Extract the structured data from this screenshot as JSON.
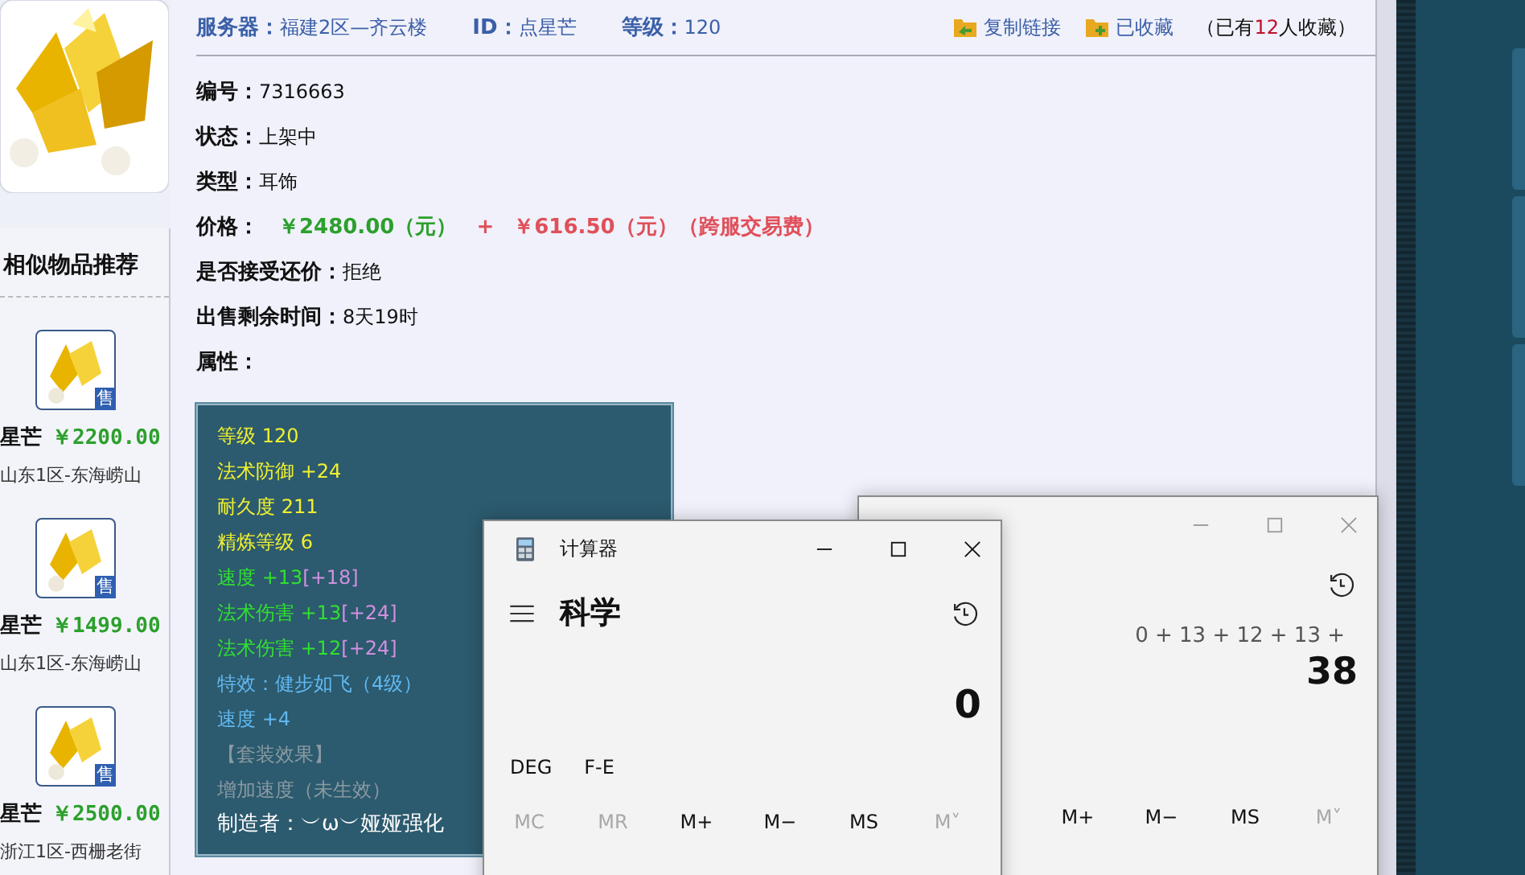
{
  "similar": {
    "title": "相似物品推荐",
    "items": [
      {
        "name": "星芒",
        "price": "￥2200.00",
        "server": "山东1区-东海崂山",
        "badge": "售"
      },
      {
        "name": "星芒",
        "price": "￥1499.00",
        "server": "山东1区-东海崂山",
        "badge": "售"
      },
      {
        "name": "星芒",
        "price": "￥2500.00",
        "server": "浙江1区-西栅老街",
        "badge": "售"
      }
    ]
  },
  "header": {
    "server_label": "服务器：",
    "server": "福建2区—齐云楼",
    "id_label": "ID：",
    "id": "点星芒",
    "level_label": "等级：",
    "level": "120",
    "copy_link": "复制链接",
    "favorite": "已收藏",
    "fav_prefix": "（已有",
    "fav_count": "12",
    "fav_suffix": "人收藏）"
  },
  "fields": [
    {
      "kind": "text",
      "label": "编号：",
      "value": "7316663"
    },
    {
      "kind": "text",
      "label": "状态：",
      "value": " 上架中"
    },
    {
      "kind": "text",
      "label": "类型：",
      "value": "耳饰"
    },
    {
      "kind": "price",
      "label": "价格：",
      "value": "￥2480.00（元）",
      "plus": "+",
      "fee": "￥616.50（元）（跨服交易费）"
    },
    {
      "kind": "text",
      "label": "是否接受还价：",
      "value": "拒绝"
    },
    {
      "kind": "text",
      "label": "出售剩余时间：",
      "value": "8天19时"
    },
    {
      "kind": "heading",
      "label": "属性："
    }
  ],
  "attributes": [
    {
      "kind": "base",
      "text": "等级 120"
    },
    {
      "kind": "base",
      "text": "法术防御 +24"
    },
    {
      "kind": "base",
      "text": "耐久度 211"
    },
    {
      "kind": "base",
      "text": "精炼等级 6"
    },
    {
      "kind": "bonus",
      "text": "速度 +13",
      "extra": "[+18]"
    },
    {
      "kind": "bonus",
      "text": "法术伤害 +13",
      "extra": "[+24]"
    },
    {
      "kind": "bonus",
      "text": "法术伤害 +12",
      "extra": "[+24]"
    },
    {
      "kind": "effect",
      "text": "特效：健步如飞（4级）"
    },
    {
      "kind": "effect",
      "text": "速度 +4"
    },
    {
      "kind": "inactive",
      "text": "【套装效果】"
    },
    {
      "kind": "inactive",
      "text": "增加速度（未生效）"
    },
    {
      "kind": "maker",
      "text": "制造者：︶ω︶娅娅强化"
    }
  ],
  "calculator_back": {
    "expression": "0 + 13 + 12 + 13 +",
    "result": "38",
    "memory_buttons": [
      {
        "label": "M+",
        "disabled": false
      },
      {
        "label": "M−",
        "disabled": false
      },
      {
        "label": "MS",
        "disabled": false
      },
      {
        "label": "M˅",
        "disabled": true
      }
    ]
  },
  "calculator_front": {
    "title": "计算器",
    "mode": "科学",
    "result": "0",
    "angle_buttons": [
      "DEG",
      "F-E"
    ],
    "memory_buttons": [
      {
        "label": "MC",
        "disabled": true
      },
      {
        "label": "MR",
        "disabled": true
      },
      {
        "label": "M+",
        "disabled": false
      },
      {
        "label": "M−",
        "disabled": false
      },
      {
        "label": "MS",
        "disabled": false
      },
      {
        "label": "M˅",
        "disabled": true
      }
    ]
  }
}
